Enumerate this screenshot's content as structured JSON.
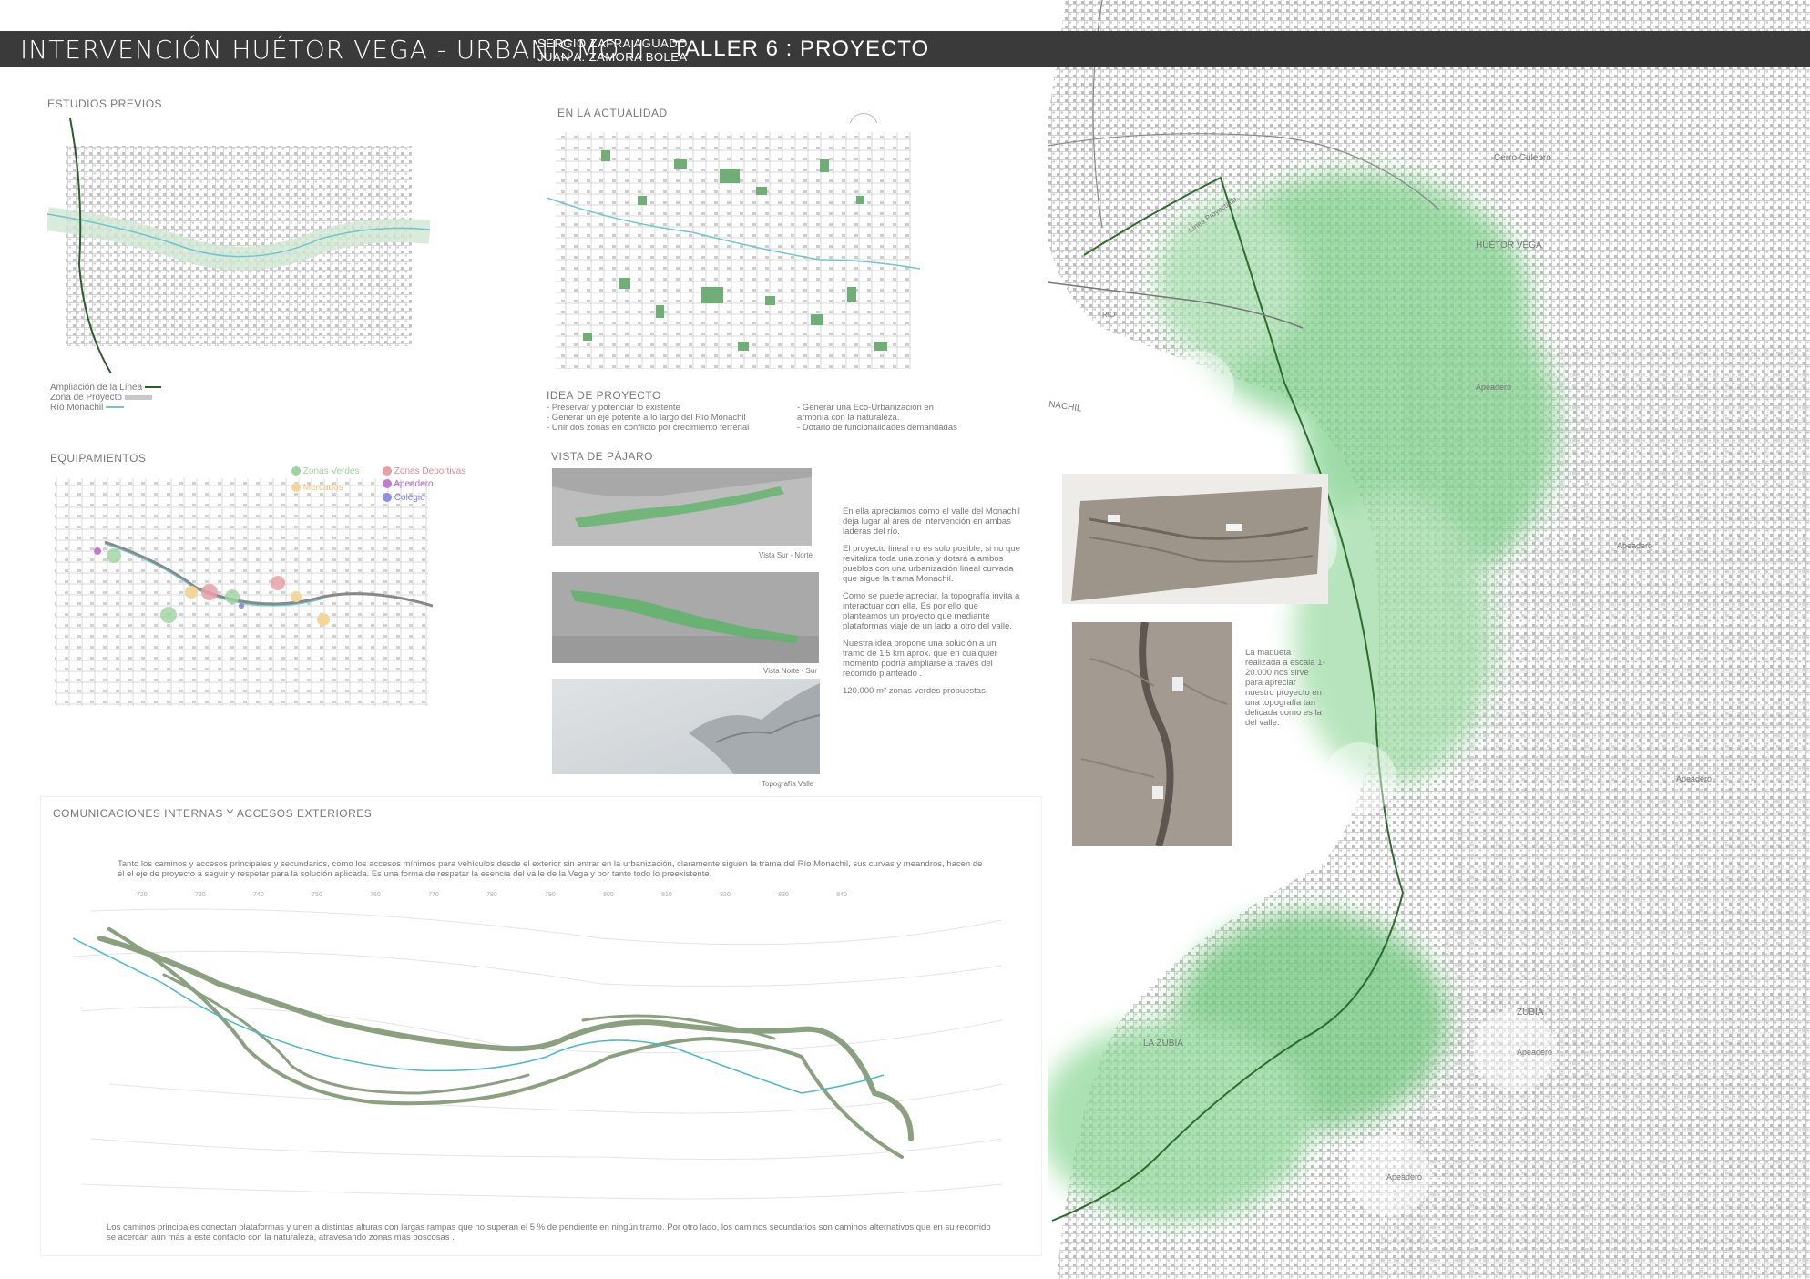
{
  "header": {
    "title": "INTERVENCIÓN HUÉTOR VEGA - URBANISMO II",
    "authors": [
      "SERGIO ZAFRA AGUADO",
      "JUAN A. ZAMORA BOLEA"
    ],
    "workshop": "TALLER 6 : PROYECTO"
  },
  "estudios": {
    "title": "ESTUDIOS PREVIOS",
    "legend": [
      {
        "label": "Ampliación de la Línea",
        "color": "#2e5e2e"
      },
      {
        "label": "Zona de Proyecto",
        "color": "#c8c8c8"
      },
      {
        "label": "Río Monachil",
        "color": "#6cc7cf"
      }
    ]
  },
  "actualidad": {
    "title": "EN LA ACTUALIDAD"
  },
  "idea": {
    "title": "IDEA DE PROYECTO",
    "col1": [
      "- Preservar y potenciar lo existente",
      "- Generar un eje potente a lo largo del Río Monachil",
      "- Unir dos zonas en conflicto por crecimiento terrenal"
    ],
    "col2": [
      "- Generar una Eco-Urbanización en",
      "armonía con la naturaleza.",
      "- Dotarlo de funcionalidades demandadas"
    ]
  },
  "equipamientos": {
    "title": "EQUIPAMIENTOS",
    "legend": [
      {
        "label": "Zonas Verdes",
        "color": "#9fd39f"
      },
      {
        "label": "Zonas Deportivas",
        "color": "#e7a0a8"
      },
      {
        "label": "Mercados",
        "color": "#f3d79a"
      },
      {
        "label": "Apeadero",
        "color": "#c07ad0"
      },
      {
        "label": "Colegio",
        "color": "#8f8fe0"
      }
    ]
  },
  "vista": {
    "title": "VISTA DE PÁJARO",
    "captions": [
      "Vista Sur - Norte",
      "Vista Norte - Sur",
      "Topografía Valle"
    ],
    "paragraphs": [
      "En ella apreciamos como el valle del Monachil deja lugar al área de intervención en ambas laderas del río.",
      "El proyecto lineal no es solo posible, si no que revitaliza toda una zona y dotará a ambos pueblos con una urbanización lineal curvada que sigue la trama Monachil.",
      "Como se puede apreciar, la topografía invita a interactuar con ella. Es por ello que planteamos un proyecto que mediante plataformas viaje de un lado a otro del valle.",
      "Nuestra idea propone una solución a un tramo de 1'5 km aprox. que en cualquier momento podría ampliarse a través del recorrido planteado .",
      "120.000 m² zonas verdes propuestas."
    ]
  },
  "maqueta": {
    "text": "La maqueta realizada a escala 1-20.000 nos sirve para apreciar nuestro proyecto en una topografía tan delicada como es la del valle."
  },
  "comunicaciones": {
    "title": "COMUNICACIONES INTERNAS Y ACCESOS EXTERIORES",
    "intro": "Tanto los caminos y accesos principales y secundarios, como los accesos mínimos para vehículos desde el exterior sin entrar en la urbanización, claramente siguen la trama del Río Monachil, sus curvas y meandros, hacen de él el eje de proyecto a seguir y respetar para la solución aplicada. Es una forma de respetar la esencia del valle de la Vega y por tanto todo lo preexistente.",
    "footer": "Los caminos principales conectan plataformas y unen a distintas alturas con largas rampas que no superan el 5 % de pendiente en ningún tramo. Por otro lado, los caminos secundarios son caminos alternativos que en su recorrido se acercan aún más a este contacto con la naturaleza, atravesando zonas más boscosas .",
    "contour_labels": [
      "720",
      "730",
      "740",
      "750",
      "760",
      "770",
      "780",
      "790",
      "800",
      "810",
      "820",
      "830",
      "840"
    ]
  },
  "map": {
    "labels": [
      "HUÉTOR VEGA",
      "LA ZUBIA",
      "ZUBIA",
      "MONACHIL",
      "Cerro Culebro",
      "Línea Proyectada",
      "RIO"
    ],
    "stops": [
      "Apeadero",
      "Apeadero",
      "Apeadero",
      "Apeadero",
      "Apeadero"
    ]
  },
  "colors": {
    "green": "#7fbf86",
    "line": "#2e6b2e",
    "river": "#4ab8c8",
    "path": "#8aa07e"
  }
}
